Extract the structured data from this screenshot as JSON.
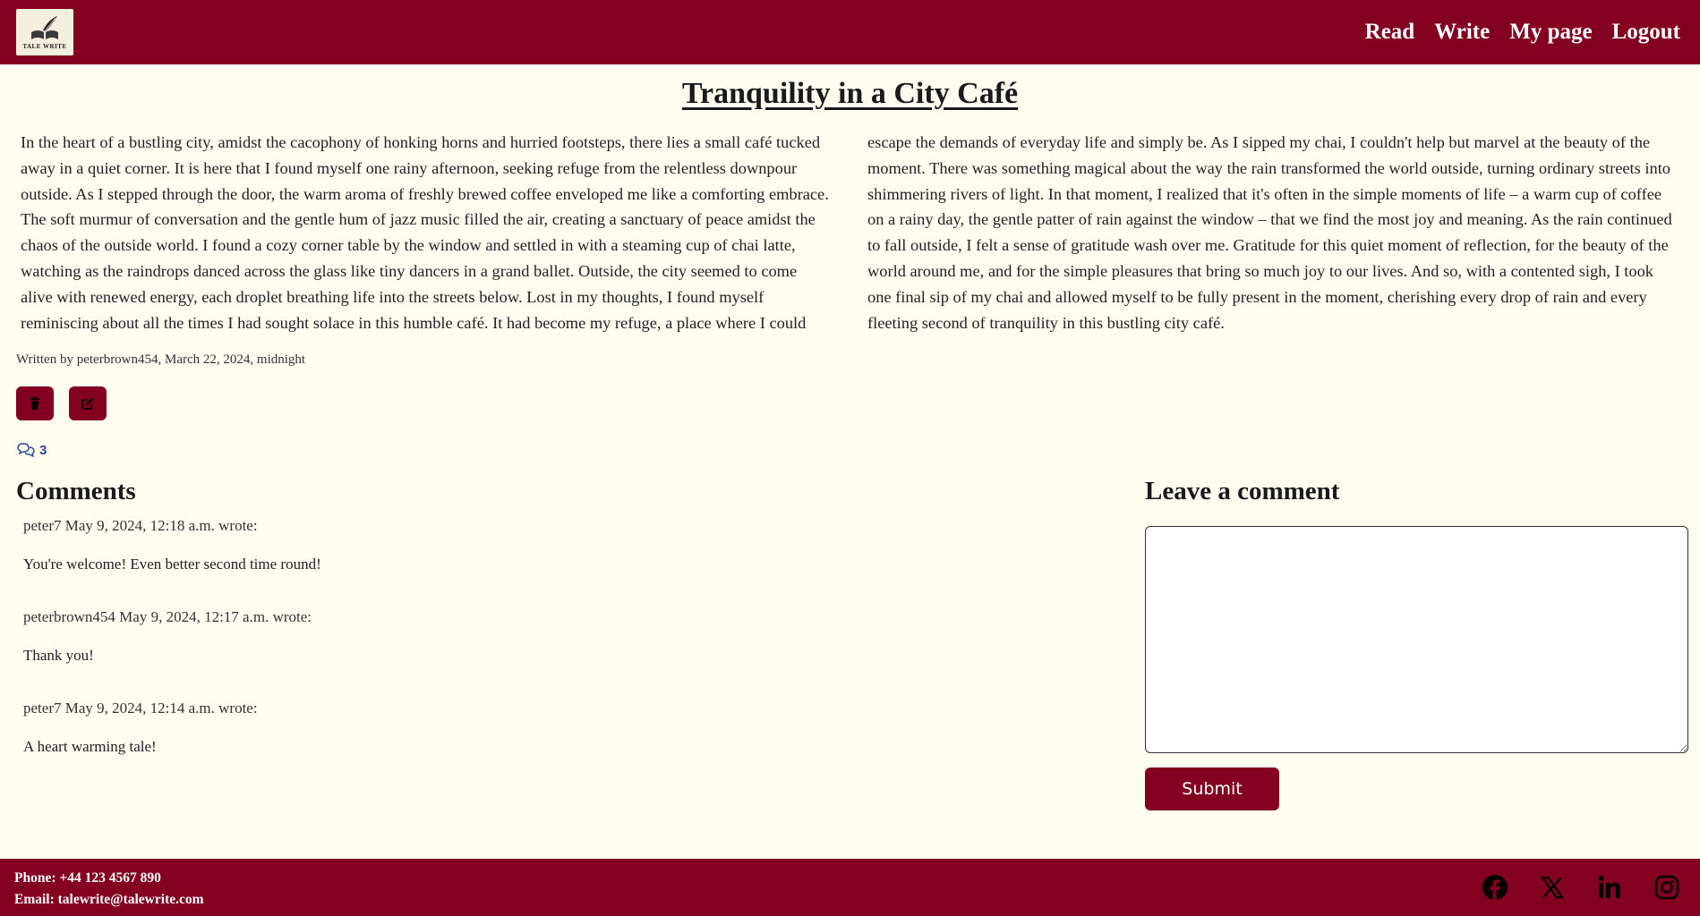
{
  "brand": {
    "logo_text": "TALE WRITE",
    "accent_color": "#830020"
  },
  "nav": {
    "read": "Read",
    "write": "Write",
    "my_page": "My page",
    "logout": "Logout"
  },
  "post": {
    "title": "Tranquility in a City Café",
    "body": "In the heart of a bustling city, amidst the cacophony of honking horns and hurried footsteps, there lies a small café tucked away in a quiet corner. It is here that I found myself one rainy afternoon, seeking refuge from the relentless downpour outside. As I stepped through the door, the warm aroma of freshly brewed coffee enveloped me like a comforting embrace. The soft murmur of conversation and the gentle hum of jazz music filled the air, creating a sanctuary of peace amidst the chaos of the outside world. I found a cozy corner table by the window and settled in with a steaming cup of chai latte, watching as the raindrops danced across the glass like tiny dancers in a grand ballet. Outside, the city seemed to come alive with renewed energy, each droplet breathing life into the streets below. Lost in my thoughts, I found myself reminiscing about all the times I had sought solace in this humble café. It had become my refuge, a place where I could escape the demands of everyday life and simply be. As I sipped my chai, I couldn't help but marvel at the beauty of the moment. There was something magical about the way the rain transformed the world outside, turning ordinary streets into shimmering rivers of light. In that moment, I realized that it's often in the simple moments of life – a warm cup of coffee on a rainy day, the gentle patter of rain against the window – that we find the most joy and meaning. As the rain continued to fall outside, I felt a sense of gratitude wash over me. Gratitude for this quiet moment of reflection, for the beauty of the world around me, and for the simple pleasures that bring so much joy to our lives. And so, with a contented sigh, I took one final sip of my chai and allowed myself to be fully present in the moment, cherishing every drop of rain and every fleeting second of tranquility in this bustling city café.",
    "byline": "Written by peterbrown454, March 22, 2024, midnight",
    "comment_count": "3"
  },
  "comments": {
    "heading": "Comments",
    "items": [
      {
        "meta": "peter7 May 9, 2024, 12:18 a.m. wrote:",
        "text": "You're welcome! Even better second time round!"
      },
      {
        "meta": "peterbrown454 May 9, 2024, 12:17 a.m. wrote:",
        "text": "Thank you!"
      },
      {
        "meta": "peter7 May 9, 2024, 12:14 a.m. wrote:",
        "text": "A heart warming tale!"
      }
    ]
  },
  "comment_form": {
    "heading": "Leave a comment",
    "value": "",
    "submit_label": "Submit"
  },
  "footer": {
    "phone": "Phone: +44 123 4567 890",
    "email": "Email: talewrite@talewrite.com",
    "socials": [
      "facebook-icon",
      "x-icon",
      "linkedin-icon",
      "instagram-icon"
    ]
  }
}
